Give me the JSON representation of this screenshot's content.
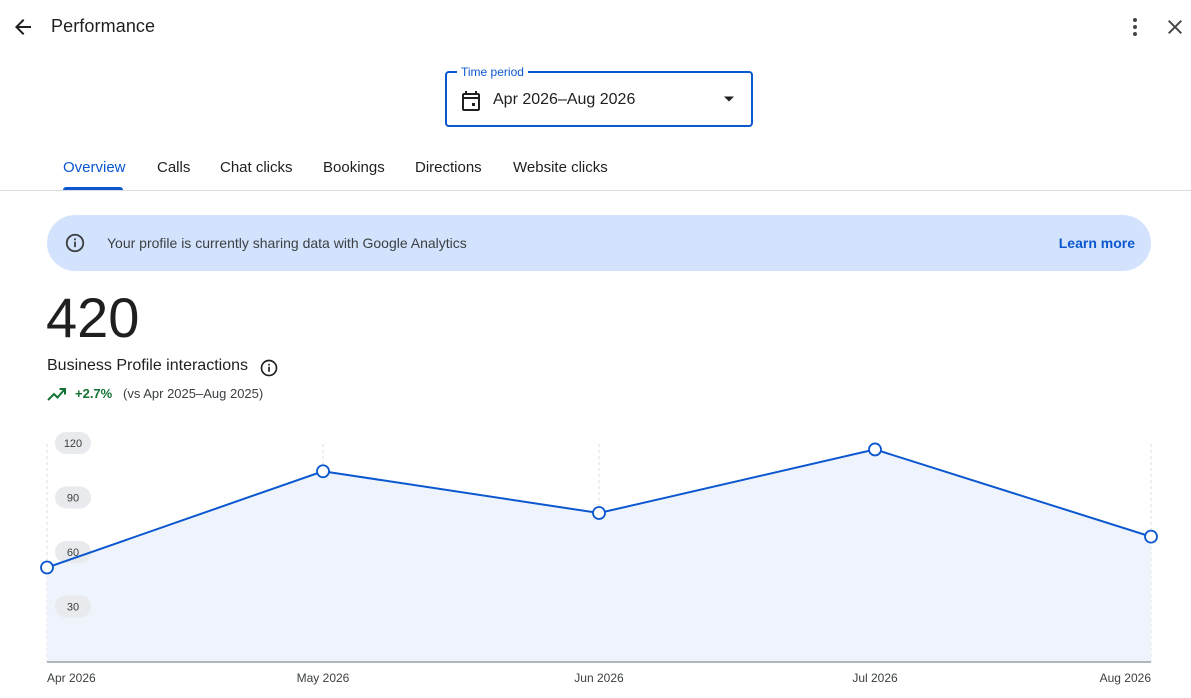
{
  "header": {
    "title": "Performance",
    "back_icon": "arrow-back-icon",
    "more_icon": "more-vert-icon",
    "close_icon": "close-icon"
  },
  "time_period": {
    "label": "Time period",
    "value": "Apr 2026–Aug 2026",
    "icon": "calendar-icon"
  },
  "tabs": [
    {
      "label": "Overview",
      "active": true
    },
    {
      "label": "Calls",
      "active": false
    },
    {
      "label": "Chat clicks",
      "active": false
    },
    {
      "label": "Bookings",
      "active": false
    },
    {
      "label": "Directions",
      "active": false
    },
    {
      "label": "Website clicks",
      "active": false
    }
  ],
  "banner": {
    "text": "Your profile is currently sharing data with Google Analytics",
    "link": "Learn more",
    "icon": "info-icon"
  },
  "metric": {
    "value": "420",
    "label": "Business Profile interactions",
    "change": "+2.7%",
    "comparison": "(vs Apr 2025–Aug 2025)",
    "trend_color": "#137333"
  },
  "colors": {
    "accent": "#0b57d0",
    "banner_bg": "#d3e3fd",
    "area_fill": "#eef3fc"
  },
  "chart_data": {
    "type": "area",
    "x": [
      "Apr 2026",
      "May 2026",
      "Jun 2026",
      "Jul 2026",
      "Aug 2026"
    ],
    "series": [
      {
        "values": [
          52,
          105,
          82,
          117,
          69
        ]
      }
    ],
    "yticks": [
      "120",
      "90",
      "60",
      "30"
    ],
    "ylim": [
      0,
      120
    ],
    "grid": "vertical-dashed"
  }
}
